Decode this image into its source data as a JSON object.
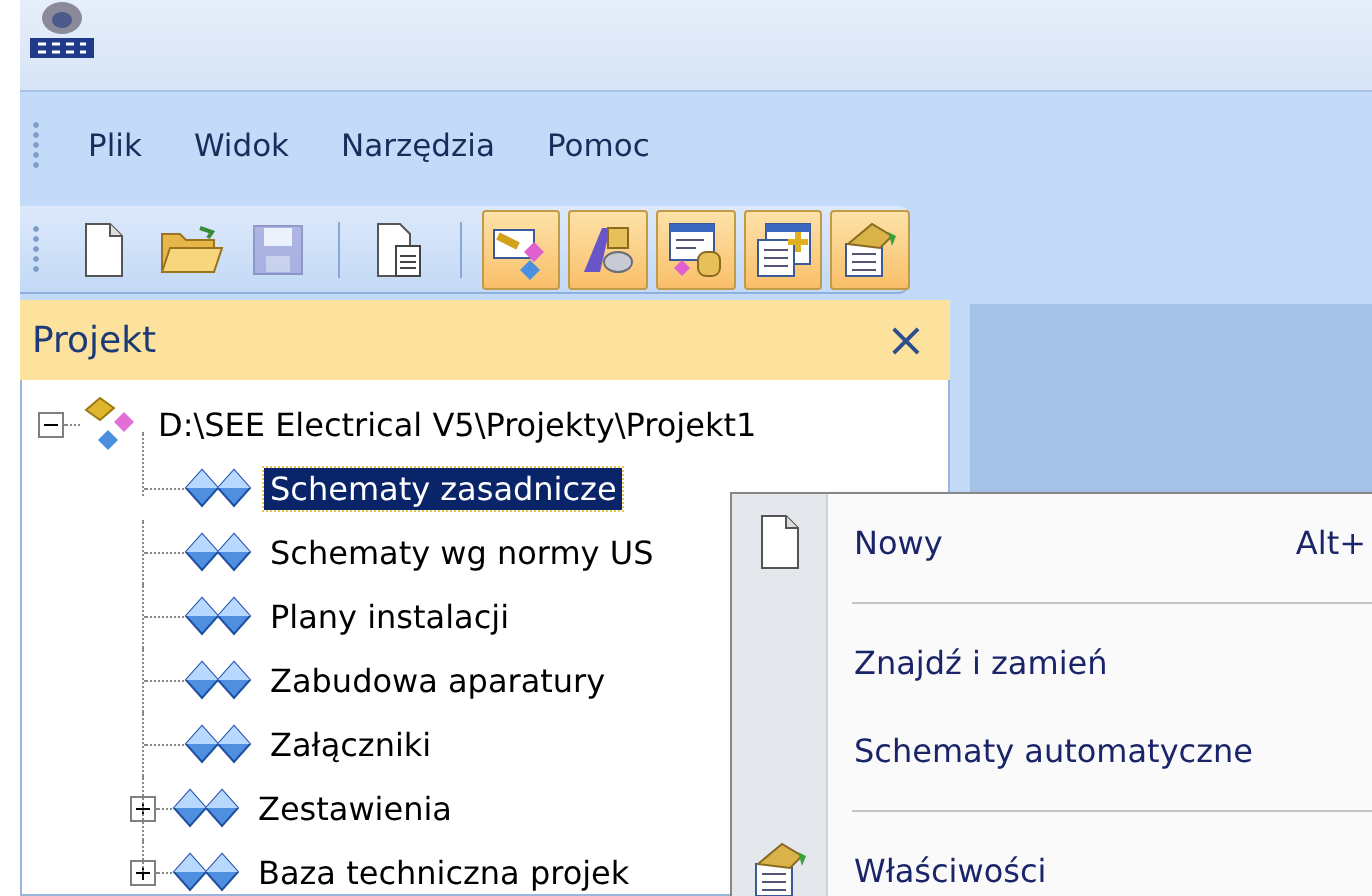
{
  "menu_bar": {
    "items": [
      "Plik",
      "Widok",
      "Narzędzia",
      "Pomoc"
    ]
  },
  "toolbar": [
    {
      "kind": "new",
      "pressed": false,
      "disabled": false
    },
    {
      "kind": "open",
      "pressed": false,
      "disabled": false
    },
    {
      "kind": "save",
      "pressed": false,
      "disabled": true
    },
    {
      "kind": "separator"
    },
    {
      "kind": "document",
      "pressed": false,
      "disabled": false
    },
    {
      "kind": "separator"
    },
    {
      "kind": "diagram",
      "pressed": true,
      "disabled": false
    },
    {
      "kind": "symbols",
      "pressed": true,
      "disabled": false
    },
    {
      "kind": "database",
      "pressed": true,
      "disabled": false
    },
    {
      "kind": "table-add",
      "pressed": true,
      "disabled": false
    },
    {
      "kind": "properties",
      "pressed": true,
      "disabled": false
    }
  ],
  "panel": {
    "title": "Projekt",
    "close": "×"
  },
  "tree": {
    "label": "D:\\SEE Electrical V5\\Projekty\\Projekt1",
    "expanded": true,
    "selected": false,
    "children": [
      {
        "label": "Schematy zasadnicze",
        "kind": "leaf",
        "selected": true
      },
      {
        "label": "Schematy wg normy US",
        "kind": "leaf",
        "selected": false
      },
      {
        "label": "Plany instalacji",
        "kind": "leaf",
        "selected": false
      },
      {
        "label": "Zabudowa aparatury",
        "kind": "leaf",
        "selected": false
      },
      {
        "label": "Załączniki",
        "kind": "leaf",
        "selected": false
      },
      {
        "label": "Zestawienia",
        "kind": "collapsed-group",
        "selected": false
      },
      {
        "label": "Baza techniczna projek",
        "kind": "collapsed-group",
        "selected": false
      }
    ]
  },
  "context_menu": [
    {
      "kind": "new",
      "label": "Nowy",
      "shortcut": "Alt+"
    },
    {
      "kind": "separator"
    },
    {
      "kind": "plain",
      "label": "Znajdź i zamień"
    },
    {
      "kind": "plain",
      "label": "Schematy automatyczne"
    },
    {
      "kind": "separator"
    },
    {
      "kind": "properties",
      "label": "Właściwości"
    }
  ]
}
